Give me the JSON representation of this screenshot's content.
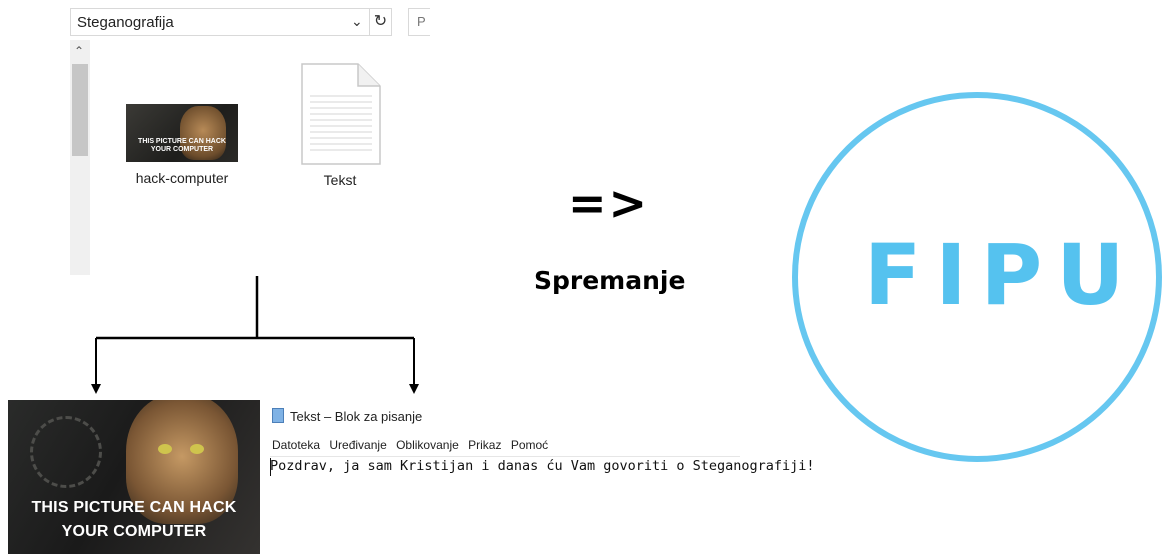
{
  "explorer": {
    "folder_name": "Steganografija",
    "search_placeholder": "P",
    "files": [
      {
        "name": "hack-computer",
        "icon": "image-thumbnail-icon",
        "thumb_text": "THIS PICTURE CAN HACK YOUR COMPUTER"
      },
      {
        "name": "Tekst",
        "icon": "text-document-icon"
      }
    ]
  },
  "output_image": {
    "text": "THIS PICTURE CAN HACK YOUR COMPUTER"
  },
  "notepad": {
    "title": "Tekst – Blok za pisanje",
    "menu": [
      "Datoteka",
      "Uređivanje",
      "Oblikovanje",
      "Prikaz",
      "Pomoć"
    ],
    "content": "Pozdrav, ja sam Kristijan i danas ću Vam govoriti o Steganografiji!"
  },
  "arrow": "=>",
  "caption": "Spremanje",
  "logo": {
    "text": "FIPU",
    "color": "#55c2ef"
  }
}
